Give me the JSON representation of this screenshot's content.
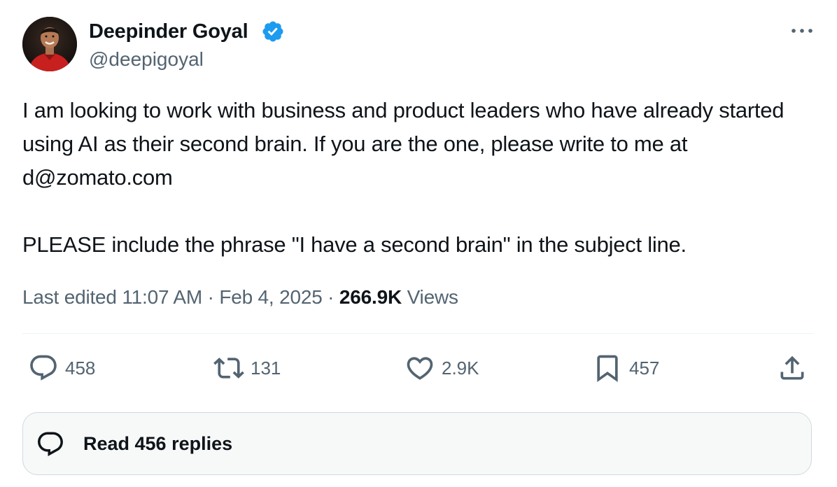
{
  "author": {
    "name": "Deepinder Goyal",
    "handle": "@deepigoyal",
    "avatar_icon": "profile-photo",
    "verified_icon": "verified-badge-icon"
  },
  "tweet": {
    "paragraph_1": "I am looking to work with business and product leaders who have already started using AI as their second brain. If you are the one, please write to me at d@zomato.com",
    "paragraph_2": "PLEASE include the phrase \"I have a second brain\" in the subject line."
  },
  "meta": {
    "edited_label": "Last edited",
    "time": "11:07 AM",
    "separator": "·",
    "date": "Feb 4, 2025",
    "views_count": "266.9K",
    "views_label": "Views"
  },
  "actions": {
    "replies": "458",
    "reposts": "131",
    "likes": "2.9K",
    "bookmarks": "457"
  },
  "read_replies": {
    "label": "Read 456 replies"
  },
  "colors": {
    "text_primary": "#0f1419",
    "text_secondary": "#536471",
    "verified_blue": "#1d9bf0",
    "border": "#cfd9de"
  }
}
